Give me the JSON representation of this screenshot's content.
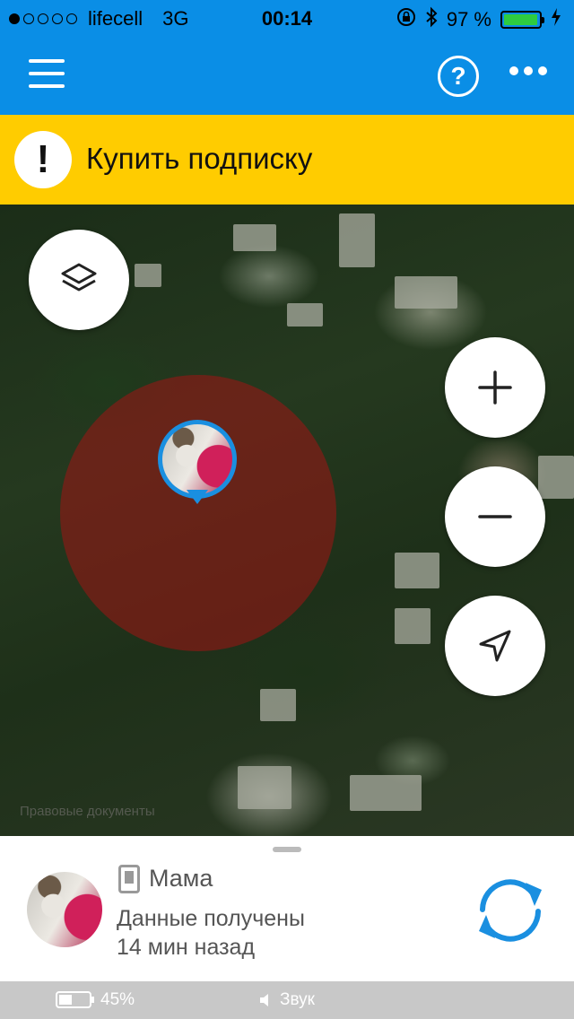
{
  "status_bar": {
    "signal_filled": 1,
    "signal_total": 5,
    "carrier": "lifecell",
    "network": "3G",
    "time": "00:14",
    "battery_percent_text": "97 %",
    "battery_level": 0.97
  },
  "app_bar": {
    "menu_icon": "hamburger-icon",
    "help_label": "?",
    "more_icon": "more-dots-icon"
  },
  "promo": {
    "icon_label": "!",
    "text": "Купить подписку",
    "color": "#ffcc00"
  },
  "map": {
    "legal_text": "Правовые документы",
    "accuracy_color": "#a01414",
    "pin_color": "#1a8fe0"
  },
  "controls": {
    "layers_icon": "layers-icon",
    "zoom_in_icon": "plus-icon",
    "zoom_out_icon": "minus-icon",
    "locate_icon": "navigation-arrow-icon"
  },
  "contact": {
    "name": "Мама",
    "status": "Данные получены",
    "time_ago": "14 мин назад",
    "refresh_icon": "refresh-icon"
  },
  "device_bar": {
    "battery_percent_text": "45%",
    "battery_level": 0.45,
    "sound_label": "Звук"
  },
  "colors": {
    "primary": "#0a8ee6",
    "accent_blue": "#1a8fe0"
  }
}
